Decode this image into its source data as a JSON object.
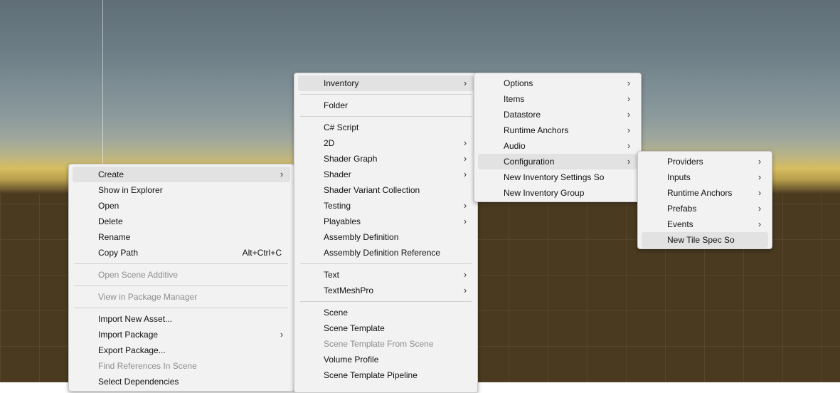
{
  "context_menu": {
    "items": [
      {
        "label": "Create",
        "submenu": true
      },
      {
        "label": "Show in Explorer"
      },
      {
        "label": "Open"
      },
      {
        "label": "Delete"
      },
      {
        "label": "Rename"
      },
      {
        "label": "Copy Path",
        "shortcut": "Alt+Ctrl+C"
      },
      {
        "label": "Open Scene Additive",
        "disabled": true
      },
      {
        "label": "View in Package Manager",
        "disabled": true
      },
      {
        "label": "Import New Asset..."
      },
      {
        "label": "Import Package",
        "submenu": true
      },
      {
        "label": "Export Package..."
      },
      {
        "label": "Find References In Scene",
        "disabled": true
      },
      {
        "label": "Select Dependencies"
      }
    ]
  },
  "create_menu": {
    "items": [
      {
        "label": "Inventory",
        "submenu": true
      },
      {
        "label": "Folder"
      },
      {
        "label": "C# Script"
      },
      {
        "label": "2D",
        "submenu": true
      },
      {
        "label": "Shader Graph",
        "submenu": true
      },
      {
        "label": "Shader",
        "submenu": true
      },
      {
        "label": "Shader Variant Collection"
      },
      {
        "label": "Testing",
        "submenu": true
      },
      {
        "label": "Playables",
        "submenu": true
      },
      {
        "label": "Assembly Definition"
      },
      {
        "label": "Assembly Definition Reference"
      },
      {
        "label": "Text",
        "submenu": true
      },
      {
        "label": "TextMeshPro",
        "submenu": true
      },
      {
        "label": "Scene"
      },
      {
        "label": "Scene Template"
      },
      {
        "label": "Scene Template From Scene",
        "disabled": true
      },
      {
        "label": "Volume Profile"
      },
      {
        "label": "Scene Template Pipeline"
      }
    ]
  },
  "inventory_menu": {
    "items": [
      {
        "label": "Options",
        "submenu": true
      },
      {
        "label": "Items",
        "submenu": true
      },
      {
        "label": "Datastore",
        "submenu": true
      },
      {
        "label": "Runtime Anchors",
        "submenu": true
      },
      {
        "label": "Audio",
        "submenu": true
      },
      {
        "label": "Configuration",
        "submenu": true
      },
      {
        "label": "New Inventory Settings So"
      },
      {
        "label": "New Inventory Group"
      }
    ]
  },
  "configuration_menu": {
    "items": [
      {
        "label": "Providers",
        "submenu": true
      },
      {
        "label": "Inputs",
        "submenu": true
      },
      {
        "label": "Runtime Anchors",
        "submenu": true
      },
      {
        "label": "Prefabs",
        "submenu": true
      },
      {
        "label": "Events",
        "submenu": true
      },
      {
        "label": "New Tile Spec So"
      }
    ]
  },
  "icons": {
    "submenu_arrow": "chevron-right-icon"
  },
  "colors": {
    "menu_bg": "#f2f2f2",
    "highlight": "#e2e2e2",
    "disabled_text": "#8d8d8d",
    "ground": "#4a3a20"
  }
}
